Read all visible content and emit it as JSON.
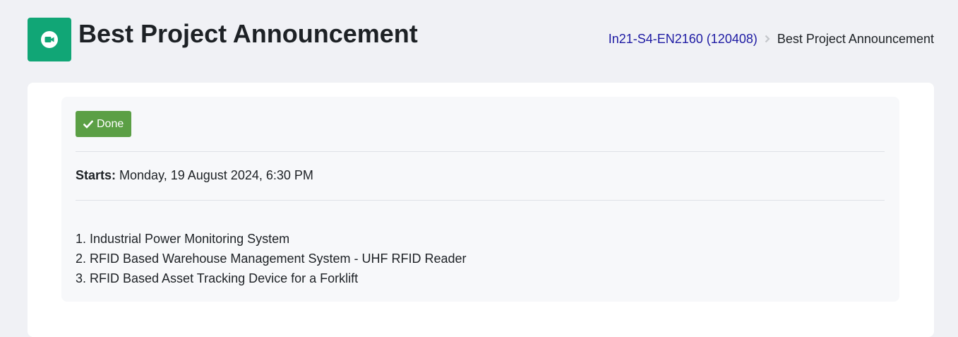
{
  "header": {
    "title": "Best Project Announcement",
    "icon": "video-camera-icon",
    "icon_color": "#11a676"
  },
  "breadcrumb": {
    "items": [
      {
        "label": "In21-S4-EN2160 (120408)",
        "link": true
      },
      {
        "label": "Best Project Announcement",
        "link": false
      }
    ],
    "link_color": "#1e1ba3"
  },
  "activity": {
    "completion_label": "Done",
    "completion_color": "#5b9f45",
    "starts_label": "Starts:",
    "starts_value": "Monday, 19 August 2024, 6:30 PM"
  },
  "description": {
    "items": [
      "1. Industrial Power Monitoring System",
      "2. RFID Based Warehouse Management System - UHF RFID Reader",
      "3. RFID Based Asset Tracking Device for a Forklift"
    ]
  }
}
